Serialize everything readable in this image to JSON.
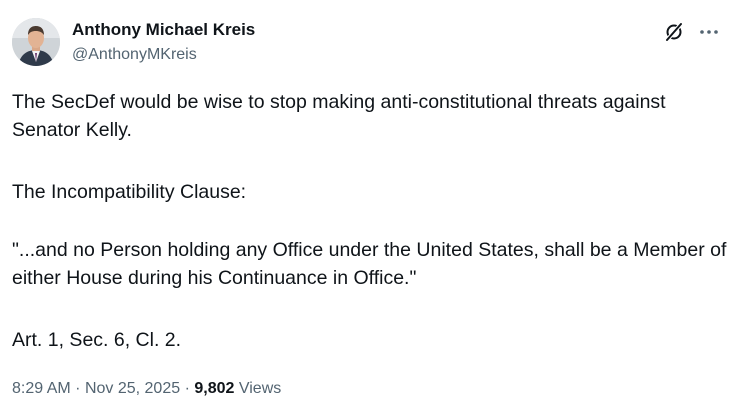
{
  "author": {
    "display_name": "Anthony Michael Kreis",
    "handle": "@AnthonyMKreis"
  },
  "icons": {
    "grok": "grok-icon",
    "more": "more-icon"
  },
  "tweet": {
    "paragraphs": [
      "The SecDef would be wise to stop making anti-constitutional threats against Senator Kelly.",
      "The Incompatibility Clause:",
      "\"...and no Person holding any Office under the United States, shall be a Member of either House during his Continuance in Office.\"",
      "Art. 1, Sec. 6, Cl. 2."
    ]
  },
  "meta": {
    "time": "8:29 AM",
    "separator": "·",
    "date": "Nov 25, 2025",
    "views_count": "9,802",
    "views_label": "Views"
  },
  "colors": {
    "primary_text": "#0f1419",
    "secondary_text": "#536471",
    "background": "#ffffff"
  }
}
